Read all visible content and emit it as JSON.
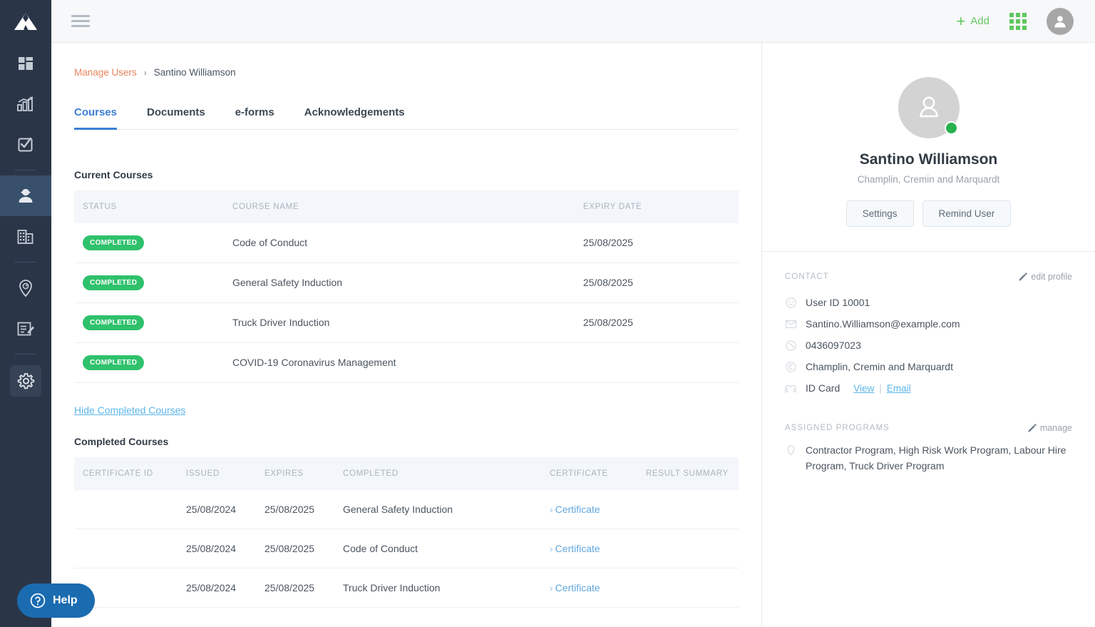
{
  "sidebar": {
    "logo_icon": "mountain-logo-icon",
    "items": [
      {
        "icon": "dashboard-icon",
        "name": "dashboard",
        "active": false
      },
      {
        "icon": "analytics-chart-icon",
        "name": "analytics",
        "active": false
      },
      {
        "icon": "checkbox-task-icon",
        "name": "tasks",
        "active": false
      },
      {
        "icon": "worker-user-icon",
        "name": "manage-users",
        "active": true
      },
      {
        "icon": "building-company-icon",
        "name": "companies",
        "active": false
      },
      {
        "icon": "location-pin-icon",
        "name": "sites",
        "active": false
      },
      {
        "icon": "form-edit-icon",
        "name": "forms",
        "active": false
      }
    ],
    "settings_icon": "gear-icon"
  },
  "topbar": {
    "menu_icon": "hamburger-menu-icon",
    "add_label": "Add",
    "add_icon": "plus-icon",
    "apps_icon": "grid-apps-icon",
    "account_icon": "user-avatar-icon"
  },
  "breadcrumb": {
    "parent": "Manage Users",
    "separator": "›",
    "current": "Santino Williamson"
  },
  "tabs": [
    {
      "label": "Courses",
      "active": true
    },
    {
      "label": "Documents",
      "active": false
    },
    {
      "label": "e-forms",
      "active": false
    },
    {
      "label": "Acknowledgements",
      "active": false
    }
  ],
  "current_courses": {
    "title": "Current Courses",
    "columns": [
      "STATUS",
      "COURSE NAME",
      "EXPIRY DATE"
    ],
    "rows": [
      {
        "status": "COMPLETED",
        "course": "Code of Conduct",
        "expiry": "25/08/2025"
      },
      {
        "status": "COMPLETED",
        "course": "General Safety Induction",
        "expiry": "25/08/2025"
      },
      {
        "status": "COMPLETED",
        "course": "Truck Driver Induction",
        "expiry": "25/08/2025"
      },
      {
        "status": "COMPLETED",
        "course": "COVID-19 Coronavirus Management",
        "expiry": ""
      }
    ]
  },
  "hide_completed_link": "Hide Completed Courses",
  "completed_courses": {
    "title": "Completed Courses",
    "columns": [
      "CERTIFICATE ID",
      "ISSUED",
      "EXPIRES",
      "COMPLETED",
      "CERTIFICATE",
      "RESULT SUMMARY"
    ],
    "certificate_link_label": "Certificate",
    "rows": [
      {
        "cert_id": "",
        "issued": "25/08/2024",
        "expires": "25/08/2025",
        "completed": "General Safety Induction",
        "certificate": "Certificate",
        "result": ""
      },
      {
        "cert_id": "",
        "issued": "25/08/2024",
        "expires": "25/08/2025",
        "completed": "Code of Conduct",
        "certificate": "Certificate",
        "result": ""
      },
      {
        "cert_id": "",
        "issued": "25/08/2024",
        "expires": "25/08/2025",
        "completed": "Truck Driver Induction",
        "certificate": "Certificate",
        "result": ""
      }
    ]
  },
  "profile": {
    "avatar_icon": "user-avatar-icon",
    "status_indicator": "online-status-dot",
    "name": "Santino Williamson",
    "organisation": "Champlin, Cremin and Marquardt",
    "settings_label": "Settings",
    "remind_label": "Remind User"
  },
  "contact": {
    "heading": "CONTACT",
    "edit_label": "edit profile",
    "edit_icon": "pencil-icon",
    "user_id": "User ID 10001",
    "user_id_icon": "user-circle-icon",
    "email": "Santino.Williamson@example.com",
    "email_icon": "envelope-icon",
    "phone": "0436097023",
    "phone_icon": "phone-icon",
    "company": "Champlin, Cremin and Marquardt",
    "company_icon": "copyright-circle-icon",
    "id_card_label": "ID Card",
    "id_card_icon": "id-card-icon",
    "view_label": "View",
    "email_link_label": "Email",
    "divider": "|"
  },
  "assigned_programs": {
    "heading": "ASSIGNED PROGRAMS",
    "manage_label": "manage",
    "manage_icon": "pencil-icon",
    "list_icon": "location-pin-icon",
    "programs": "Contractor Program, High Risk Work Program, Labour Hire Program, Truck Driver Program"
  },
  "help": {
    "label": "Help",
    "icon": "question-circle-icon"
  },
  "colors": {
    "sidebar_bg": "#2a3648",
    "sidebar_active": "#38506b",
    "accent_green": "#5ec75e",
    "badge_green": "#2fc16c",
    "tab_active_blue": "#3c7fd4",
    "link_blue": "#5bb5e8",
    "breadcrumb_orange": "#e8835a",
    "help_blue": "#1a6bb0"
  }
}
